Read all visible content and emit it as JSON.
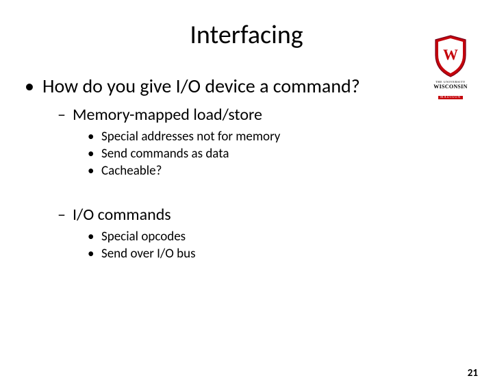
{
  "title": "Interfacing",
  "logo": {
    "line1": "THE UNIVERSITY",
    "line2": "WISCONSIN",
    "line3": "MADISON"
  },
  "bullets": {
    "l1_0": "How do you give I/O device a command?",
    "l2_0": "Memory-mapped load/store",
    "l3_0": "Special addresses not for memory",
    "l3_1": "Send commands as data",
    "l3_2": "Cacheable?",
    "l2_1": "I/O commands",
    "l3_3": "Special opcodes",
    "l3_4": "Send over I/O bus"
  },
  "page_number": "21"
}
